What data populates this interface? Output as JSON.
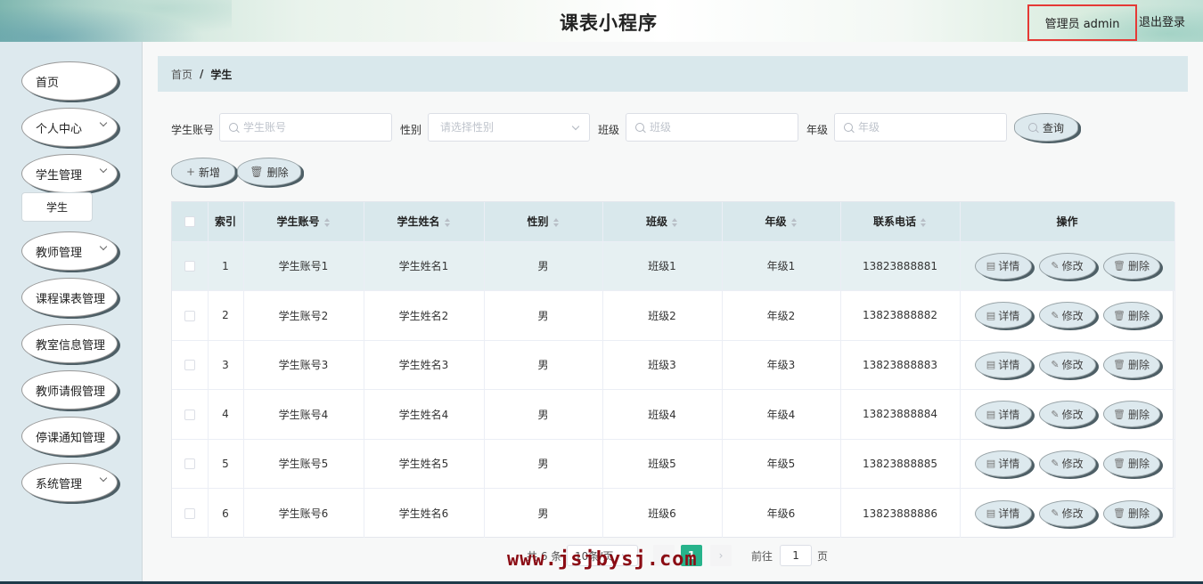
{
  "header": {
    "title": "课表小程序",
    "user_label": "管理员 admin",
    "logout_label": "退出登录"
  },
  "sidebar": {
    "items": [
      {
        "label": "首页",
        "has_arrow": false
      },
      {
        "label": "个人中心",
        "has_arrow": true
      },
      {
        "label": "学生管理",
        "has_arrow": true
      },
      {
        "label": "教师管理",
        "has_arrow": true
      },
      {
        "label": "课程课表管理",
        "has_arrow": false
      },
      {
        "label": "教室信息管理",
        "has_arrow": false
      },
      {
        "label": "教师请假管理",
        "has_arrow": false
      },
      {
        "label": "停课通知管理",
        "has_arrow": false
      },
      {
        "label": "系统管理",
        "has_arrow": true
      }
    ],
    "sub_item": "学生"
  },
  "breadcrumb": {
    "home": "首页",
    "separator": "/",
    "current": "学生"
  },
  "search": {
    "account_label": "学生账号",
    "account_placeholder": "学生账号",
    "gender_label": "性别",
    "gender_placeholder": "请选择性别",
    "class_label": "班级",
    "class_placeholder": "班级",
    "grade_label": "年级",
    "grade_placeholder": "年级",
    "query_button": "查询"
  },
  "actions": {
    "add_button": "新增",
    "delete_button": "删除"
  },
  "table": {
    "columns": [
      "索引",
      "学生账号",
      "学生姓名",
      "性别",
      "班级",
      "年级",
      "联系电话",
      "操作"
    ],
    "rows": [
      {
        "index": "1",
        "account": "学生账号1",
        "name": "学生姓名1",
        "gender": "男",
        "class": "班级1",
        "grade": "年级1",
        "phone": "13823888881"
      },
      {
        "index": "2",
        "account": "学生账号2",
        "name": "学生姓名2",
        "gender": "男",
        "class": "班级2",
        "grade": "年级2",
        "phone": "13823888882"
      },
      {
        "index": "3",
        "account": "学生账号3",
        "name": "学生姓名3",
        "gender": "男",
        "class": "班级3",
        "grade": "年级3",
        "phone": "13823888883"
      },
      {
        "index": "4",
        "account": "学生账号4",
        "name": "学生姓名4",
        "gender": "男",
        "class": "班级4",
        "grade": "年级4",
        "phone": "13823888884"
      },
      {
        "index": "5",
        "account": "学生账号5",
        "name": "学生姓名5",
        "gender": "男",
        "class": "班级5",
        "grade": "年级5",
        "phone": "13823888885"
      },
      {
        "index": "6",
        "account": "学生账号6",
        "name": "学生姓名6",
        "gender": "男",
        "class": "班级6",
        "grade": "年级6",
        "phone": "13823888886"
      }
    ],
    "row_actions": {
      "detail": "详情",
      "edit": "修改",
      "delete": "删除"
    }
  },
  "pagination": {
    "total_text": "共 6 条",
    "page_size": "10条/页",
    "current_page": "1",
    "goto_prefix": "前往",
    "goto_value": "1",
    "goto_suffix": "页",
    "prev": "‹",
    "next": "›"
  },
  "watermark": "www.jsjbysj.com",
  "colors": {
    "accent": "#27b38b",
    "sidebar_bg": "#dde9ee",
    "header_row_bg": "#d9e8ec",
    "highlight_box": "#e53935",
    "watermark": "#8b0c14"
  }
}
